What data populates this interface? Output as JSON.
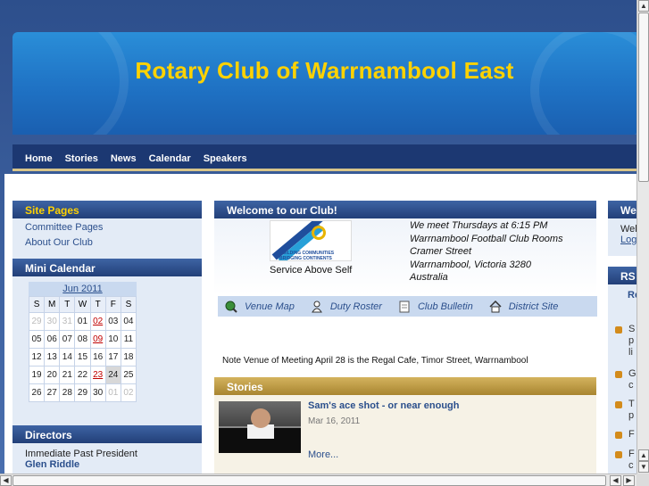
{
  "header": {
    "site_title": "Rotary Club of Warrnambool East"
  },
  "nav": {
    "items": [
      "Home",
      "Stories",
      "News",
      "Calendar",
      "Speakers"
    ]
  },
  "site_pages": {
    "title": "Site Pages",
    "links": [
      "Committee Pages",
      "About Our Club"
    ]
  },
  "mini_calendar": {
    "title": "Mini Calendar",
    "month": "Jun 2011",
    "weekdays": [
      "S",
      "M",
      "T",
      "W",
      "T",
      "F",
      "S"
    ],
    "weeks": [
      [
        "29",
        "30",
        "31",
        "01",
        "02",
        "03",
        "04"
      ],
      [
        "05",
        "06",
        "07",
        "08",
        "09",
        "10",
        "11"
      ],
      [
        "12",
        "13",
        "14",
        "15",
        "16",
        "17",
        "18"
      ],
      [
        "19",
        "20",
        "21",
        "22",
        "23",
        "24",
        "25"
      ],
      [
        "26",
        "27",
        "28",
        "29",
        "30",
        "01",
        "02"
      ]
    ]
  },
  "directors": {
    "title": "Directors",
    "role": "Immediate Past President",
    "name": "Glen Riddle"
  },
  "welcome": {
    "title": "Welcome to our Club!",
    "logo_text": "BUILDING COMMUNITIES BRIDGING CONTINENTS",
    "motto": "Service Above Self",
    "meeting_lines": [
      "We meet Thursdays at 6:15 PM",
      "Warrnambool Football Club Rooms",
      "Cramer Street",
      "Warrnambool, Victoria 3280",
      "Australia"
    ]
  },
  "quick_links": [
    {
      "label": "Venue Map",
      "icon": "magnifier-globe-icon"
    },
    {
      "label": "Duty Roster",
      "icon": "person-icon"
    },
    {
      "label": "Club Bulletin",
      "icon": "document-icon"
    },
    {
      "label": "District Site",
      "icon": "home-icon"
    }
  ],
  "note": "Note Venue of Meeting April 28 is the Regal Cafe, Timor Street, Warrnambool",
  "stories": {
    "title": "Stories",
    "item_title": "Sam's ace shot - or near enough",
    "item_date": "Mar 16, 2011",
    "more": "More..."
  },
  "right_col": {
    "box1_title": "We",
    "box1_line1": "Wel",
    "box1_line2": "Log",
    "box2_title": "RS",
    "box2_sub": "Re",
    "items": [
      [
        "S",
        "p",
        "li"
      ],
      [
        "G",
        "c"
      ],
      [
        "T",
        "p"
      ],
      [
        "F"
      ],
      [
        "F",
        "c"
      ]
    ]
  },
  "colors": {
    "nav_bg": "#1c3872",
    "banner_blue": "#1f72c4",
    "title_yellow": "#ffd200",
    "link_blue": "#2b4f8c",
    "event_red": "#c00000",
    "stories_gold": "#c4a24a"
  }
}
